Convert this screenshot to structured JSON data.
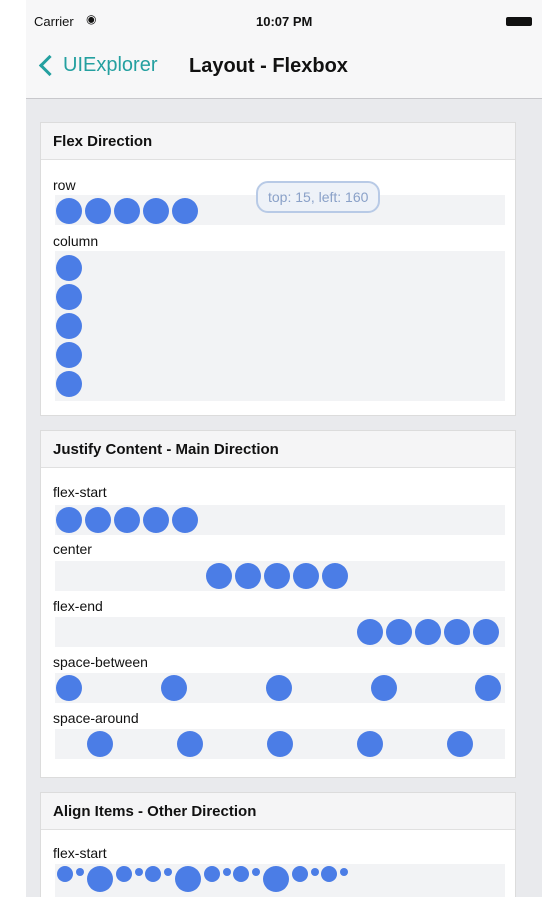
{
  "status": {
    "carrier": "Carrier",
    "time": "10:07 PM"
  },
  "nav": {
    "back_label": "UIExplorer",
    "title": "Layout - Flexbox"
  },
  "sections": {
    "flex_direction": {
      "title": "Flex Direction",
      "row_label": "row",
      "column_label": "column",
      "tooltip": "top: 15, left: 160"
    },
    "justify": {
      "title": "Justify Content - Main Direction",
      "labels": [
        "flex-start",
        "center",
        "flex-end",
        "space-between",
        "space-around"
      ]
    },
    "align": {
      "title": "Align Items - Other Direction",
      "labels": [
        "flex-start"
      ]
    }
  },
  "colors": {
    "accent": "#24a0a0",
    "dot": "#4b7de6"
  },
  "icons": {
    "back": "chevron-left-icon",
    "wifi": "wifi-icon",
    "battery": "battery-icon"
  }
}
